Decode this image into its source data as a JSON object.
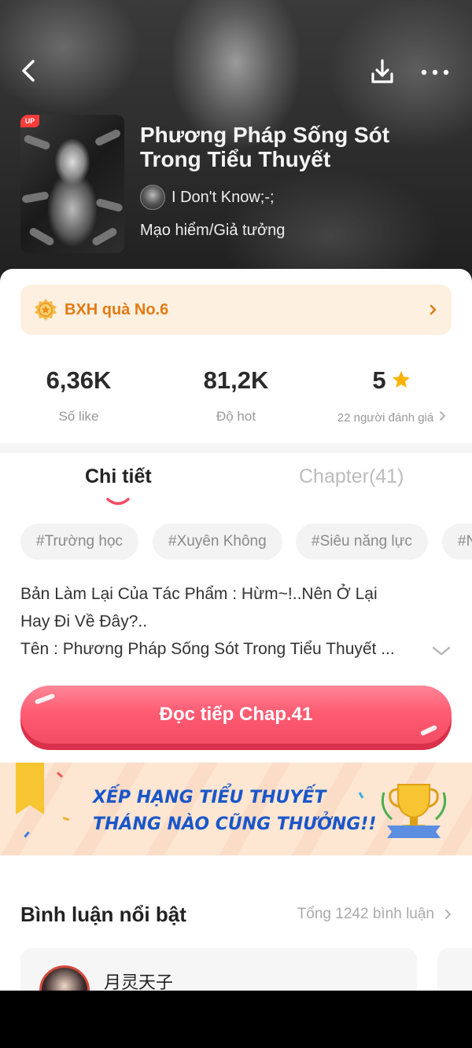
{
  "header": {
    "title": "Phương Pháp Sống Sót Trong Tiểu Thuyết",
    "author": "I Don't Know;-;",
    "genre": "Mạo hiểm/Giả tưởng",
    "cover_badge": "UP",
    "icons": [
      "back-arrow-icon",
      "download-icon",
      "more-icon"
    ]
  },
  "rank": {
    "label": "BXH quà No.6",
    "color": "#e47a12"
  },
  "stats": {
    "likes_value": "6,36K",
    "likes_label": "Số like",
    "hot_value": "81,2K",
    "hot_label": "Độ hot",
    "rating_value": "5",
    "rating_label": "22 người đánh giá"
  },
  "tabs": {
    "detail": "Chi tiết",
    "chapter": "Chapter(41)",
    "active": "detail"
  },
  "tags": [
    "#Trường học",
    "#Xuyên Không",
    "#Siêu năng lực",
    "#N"
  ],
  "description": {
    "line1": "Bản Làm Lại Của Tác Phẩm : Hừm~!..Nên Ở Lại",
    "line2": "Hay Đi Về Đây?..",
    "line3": "Tên : Phương Pháp Sống Sót Trong Tiểu Thuyết ..."
  },
  "read_button": {
    "label": "Đọc tiếp Chap.41",
    "color": "#f34c65"
  },
  "promo": {
    "line1": "XẾP HẠNG TIỂU THUYẾT",
    "line2": "THÁNG NÀO CŨNG THƯỞNG!!"
  },
  "comments": {
    "title": "Bình luận nổi bật",
    "total": "Tổng 1242 bình luận",
    "first_user": "月灵天子"
  }
}
